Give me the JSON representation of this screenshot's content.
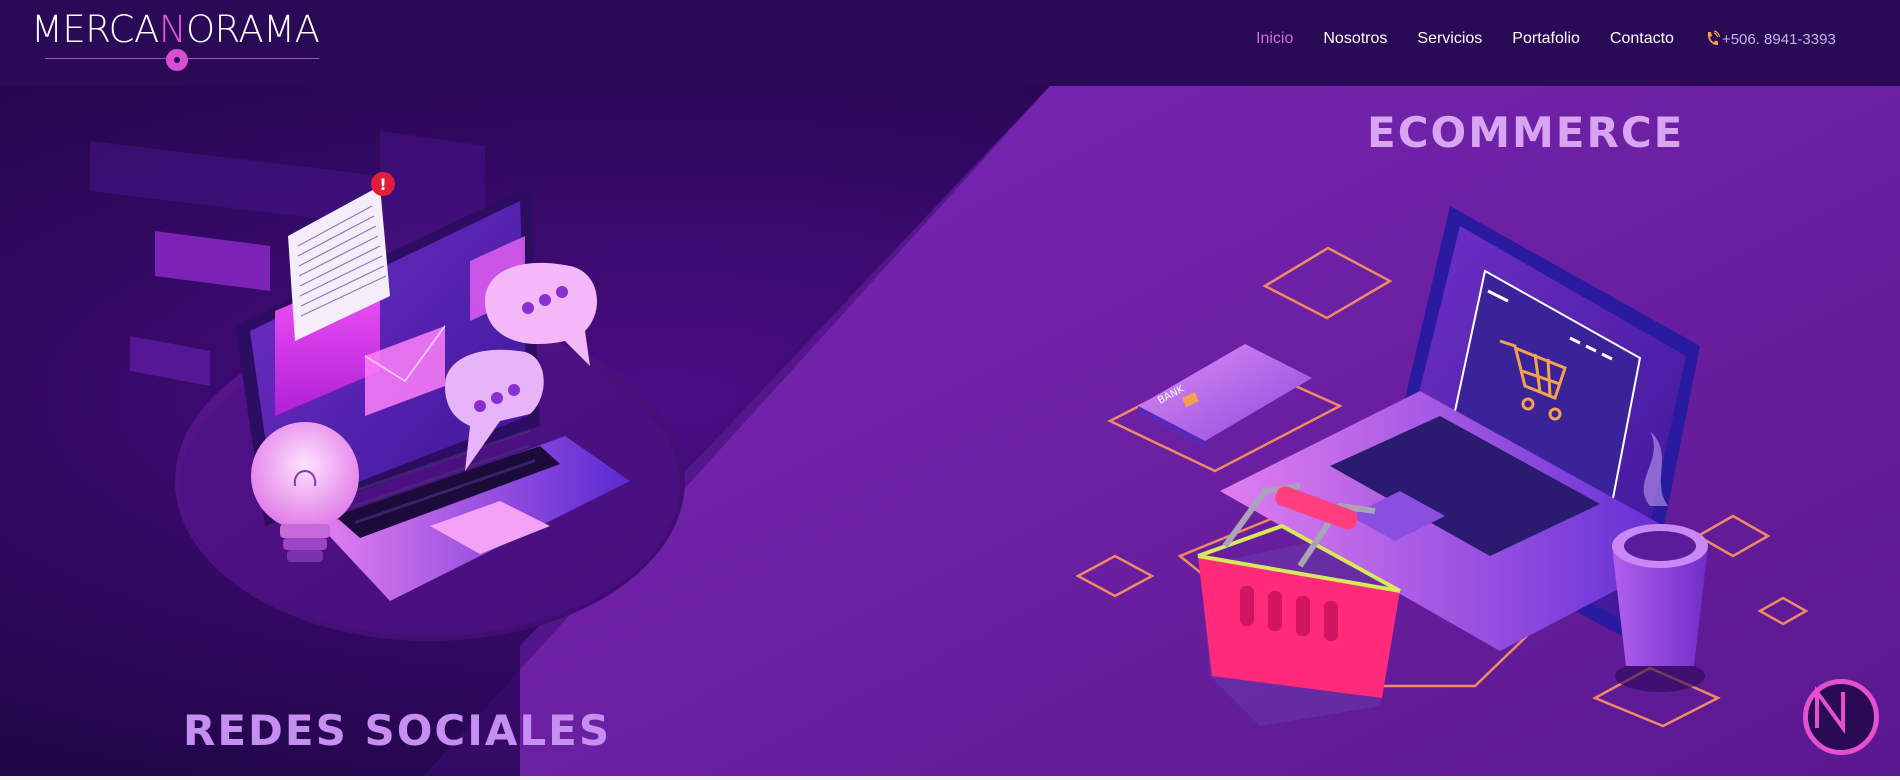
{
  "brand": {
    "name_part1": "MERCA",
    "name_highlight": "N",
    "name_part2": "ORAMA",
    "accent": "#e25ad7"
  },
  "nav": {
    "items": [
      {
        "label": "Inicio",
        "active": true
      },
      {
        "label": "Nosotros",
        "active": false
      },
      {
        "label": "Servicios",
        "active": false
      },
      {
        "label": "Portafolio",
        "active": false
      },
      {
        "label": "Contacto",
        "active": false
      }
    ],
    "phone": "+506. 8941-3393",
    "phone_icon": "phone-icon"
  },
  "hero": {
    "ecommerce_title": "ECOMMERCE",
    "redes_title": "REDES SOCIALES",
    "card_label": "BANK",
    "background": "#1a0538",
    "panel_color": "#6a1fa6"
  },
  "floating_badge": {
    "icon": "n-logo-icon"
  }
}
